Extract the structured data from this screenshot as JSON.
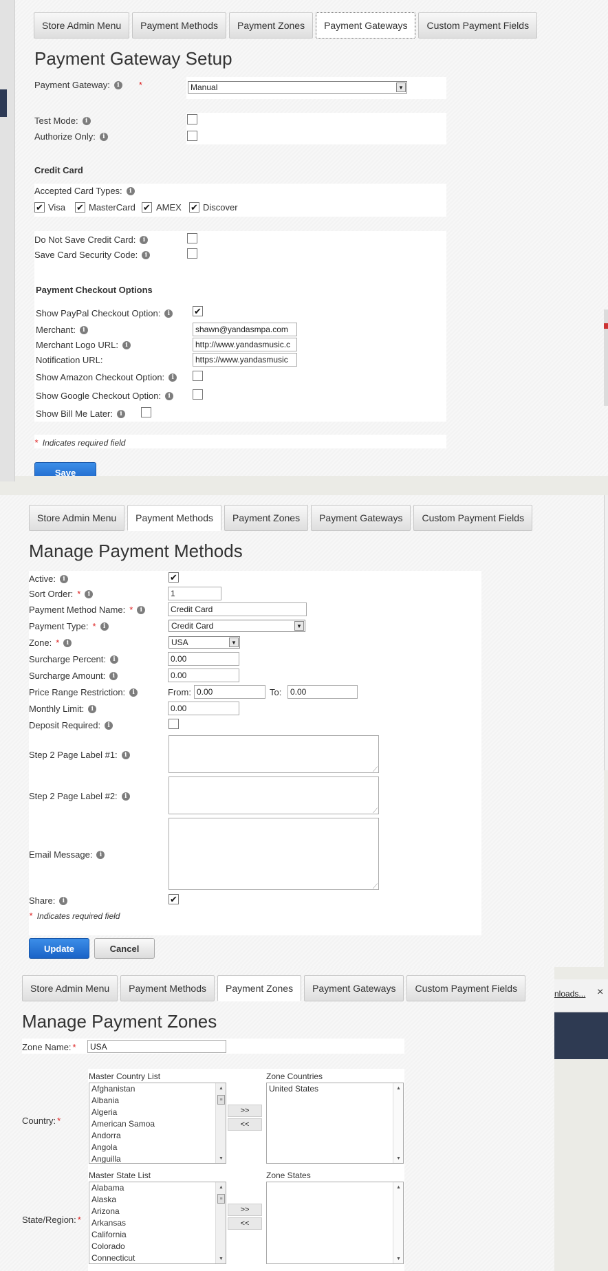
{
  "gateway": {
    "tabs": [
      "Store Admin Menu",
      "Payment Methods",
      "Payment Zones",
      "Payment Gateways",
      "Custom Payment Fields"
    ],
    "title": "Payment Gateway Setup",
    "payment_gateway_label": "Payment Gateway:",
    "payment_gateway_value": "Manual",
    "test_mode_label": "Test Mode:",
    "authorize_only_label": "Authorize Only:",
    "credit_card_title": "Credit Card",
    "accepted_types_label": "Accepted Card Types:",
    "card_types": [
      "Visa",
      "MasterCard",
      "AMEX",
      "Discover"
    ],
    "do_not_save_label": "Do Not Save Credit Card:",
    "save_security_label": "Save Card Security Code:",
    "checkout_title": "Payment Checkout Options",
    "show_paypal_label": "Show PayPal Checkout Option:",
    "merchant_label": "Merchant:",
    "merchant_value": "shawn@yandasmpa.com",
    "merchant_logo_label": "Merchant Logo URL:",
    "merchant_logo_value": "http://www.yandasmusic.c",
    "notification_label": "Notification URL:",
    "notification_value": "https://www.yandasmusic",
    "show_amazon_label": "Show Amazon Checkout Option:",
    "show_google_label": "Show Google Checkout Option:",
    "show_bill_label": "Show Bill Me Later:",
    "required_note": "Indicates required field",
    "save_label": "Save"
  },
  "methods": {
    "tabs": [
      "Store Admin Menu",
      "Payment Methods",
      "Payment Zones",
      "Payment Gateways",
      "Custom Payment Fields"
    ],
    "title": "Manage Payment Methods",
    "active_label": "Active:",
    "sort_order_label": "Sort Order:",
    "sort_order_value": "1",
    "name_label": "Payment Method Name:",
    "name_value": "Credit Card",
    "type_label": "Payment Type:",
    "type_value": "Credit Card",
    "zone_label": "Zone:",
    "zone_value": "USA",
    "surcharge_percent_label": "Surcharge Percent:",
    "surcharge_percent_value": "0.00",
    "surcharge_amount_label": "Surcharge Amount:",
    "surcharge_amount_value": "0.00",
    "price_range_label": "Price Range Restriction:",
    "from_label": "From:",
    "from_value": "0.00",
    "to_label": "To:",
    "to_value": "0.00",
    "monthly_limit_label": "Monthly Limit:",
    "monthly_limit_value": "0.00",
    "deposit_label": "Deposit Required:",
    "step2_label1": "Step 2 Page Label #1:",
    "step2_label2": "Step 2 Page Label #2:",
    "email_label": "Email Message:",
    "share_label": "Share:",
    "required_note": "Indicates required field",
    "update_label": "Update",
    "cancel_label": "Cancel"
  },
  "zones": {
    "tabs": [
      "Store Admin Menu",
      "Payment Methods",
      "Payment Zones",
      "Payment Gateways",
      "Custom Payment Fields"
    ],
    "title": "Manage Payment Zones",
    "zone_name_label": "Zone Name:",
    "zone_name_value": "USA",
    "country_label": "Country:",
    "master_country_title": "Master Country List",
    "countries": [
      "Afghanistan",
      "Albania",
      "Algeria",
      "American Samoa",
      "Andorra",
      "Angola",
      "Anguilla"
    ],
    "zone_countries_title": "Zone Countries",
    "zone_countries": [
      "United States"
    ],
    "add_label": ">>",
    "remove_label": "<<",
    "state_label": "State/Region:",
    "master_state_title": "Master State List",
    "states": [
      "Alabama",
      "Alaska",
      "Arizona",
      "Arkansas",
      "California",
      "Colorado",
      "Connecticut"
    ],
    "zone_states_title": "Zone States",
    "zone_states": []
  },
  "browser": {
    "downloads_text": "nloads...",
    "close_glyph": "×"
  },
  "colors": {
    "primary_button": "#1a63c7",
    "required": "#dd2222"
  }
}
